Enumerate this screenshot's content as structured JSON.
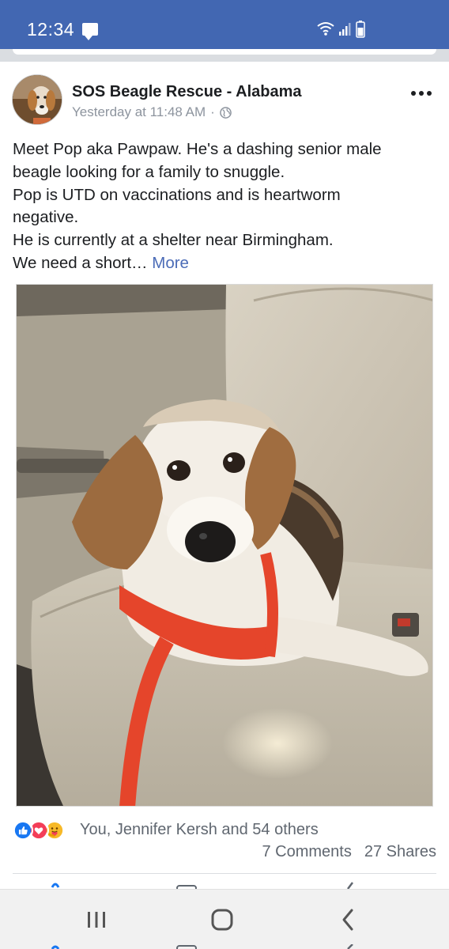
{
  "status_bar": {
    "time": "12:34",
    "bg_color": "#4267b2",
    "icons": [
      "message-icon",
      "wifi-icon",
      "signal-icon",
      "battery-icon"
    ]
  },
  "post": {
    "page_name": "SOS Beagle Rescue - Alabama",
    "timestamp": "Yesterday at 11:48 AM",
    "separator": "·",
    "audience_icon": "globe-icon",
    "text_lines": [
      "Meet Pop aka Pawpaw. He's a dashing senior male",
      "beagle looking for a family to snuggle.",
      "Pop is UTD on vaccinations and is heartworm",
      "negative.",
      "He is currently at a shelter near Birmingham.",
      "We need a short…"
    ],
    "more_label": "More",
    "link_color": "#4b6cb7"
  },
  "engagement": {
    "reaction_icons": [
      "like-icon",
      "love-icon",
      "care-icon"
    ],
    "reaction_summary": "You, Jennifer Kersh and 54 others",
    "comments": "7 Comments",
    "shares": "27 Shares"
  },
  "nav_bar": {
    "buttons": [
      "recent-apps-icon",
      "home-icon",
      "back-icon"
    ]
  }
}
